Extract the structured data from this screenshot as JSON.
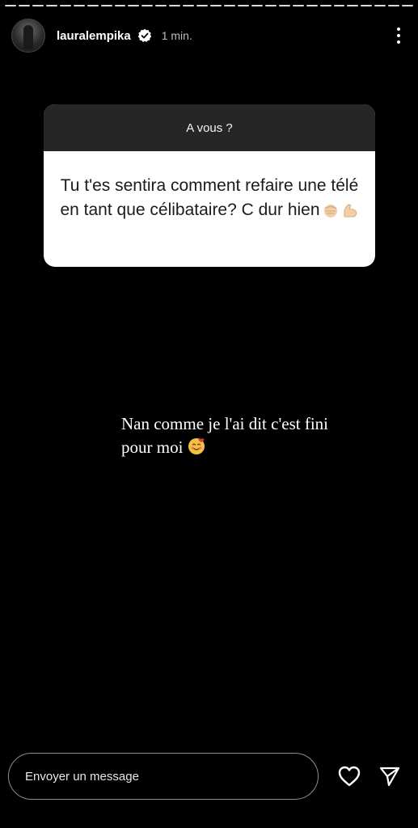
{
  "story": {
    "username": "lauralempika",
    "time": "1 min.",
    "progress_segments": 30
  },
  "question": {
    "header": "A vous ?",
    "text": "Tu t'es sentira comment refaire une télé en tant que célibataire? C dur hien",
    "emojis": [
      "fist-emoji",
      "flexed-biceps-emoji"
    ]
  },
  "answer": {
    "text": "Nan comme je l'ai dit c'est fini pour moi",
    "emoji": "smiling-face-with-hearts-emoji"
  },
  "composer": {
    "placeholder": "Envoyer un message"
  },
  "icons": {
    "verified": "verified-badge-icon",
    "more": "more-options-icon",
    "like": "heart-icon",
    "send": "send-icon"
  },
  "colors": {
    "background": "#000000",
    "question_header": "#262626",
    "question_body": "#ffffff",
    "verified_badge": "#ffffff"
  }
}
